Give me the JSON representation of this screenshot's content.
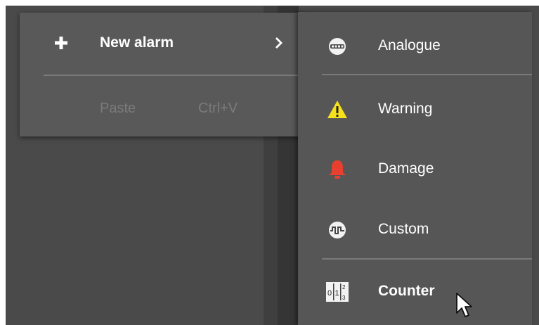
{
  "context_menu": {
    "new_alarm_label": "New alarm",
    "paste_label": "Paste",
    "paste_shortcut": "Ctrl+V"
  },
  "submenu": {
    "items": [
      {
        "label": "Analogue",
        "icon": "analogue-icon"
      },
      {
        "label": "Warning",
        "icon": "warning-icon"
      },
      {
        "label": "Damage",
        "icon": "bell-icon"
      },
      {
        "label": "Custom",
        "icon": "custom-wave-icon"
      },
      {
        "label": "Counter",
        "icon": "counter-icon",
        "hovered": true
      }
    ],
    "counter_icon_digits": [
      "0",
      "1",
      "2",
      "3"
    ]
  },
  "colors": {
    "menu_bg": "#595959",
    "submenu_bg": "#565656",
    "warning_yellow": "#f7e11b",
    "damage_red": "#e8402e",
    "disabled_text": "#7b7b7b"
  }
}
